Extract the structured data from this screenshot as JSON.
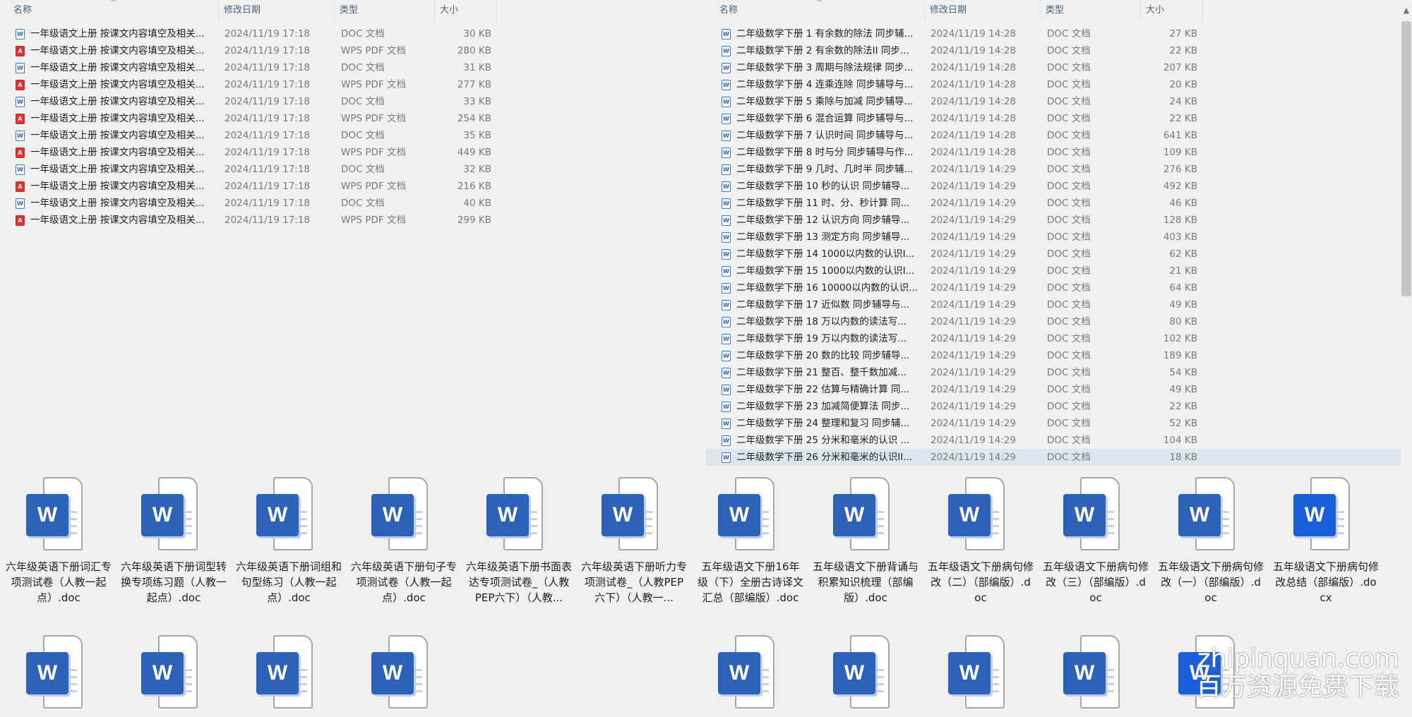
{
  "headers": {
    "name": "名称",
    "date": "修改日期",
    "type": "类型",
    "size": "大小"
  },
  "left_files": [
    {
      "name": "一年级语文上册 按课文内容填空及相关...",
      "date": "2024/11/19 17:18",
      "type": "DOC 文档",
      "size": "30 KB",
      "icon": "word-doc-icon"
    },
    {
      "name": "一年级语文上册 按课文内容填空及相关...",
      "date": "2024/11/19 17:18",
      "type": "WPS PDF 文档",
      "size": "280 KB",
      "icon": "pdf-icon"
    },
    {
      "name": "一年级语文上册 按课文内容填空及相关...",
      "date": "2024/11/19 17:18",
      "type": "DOC 文档",
      "size": "31 KB",
      "icon": "word-doc-icon"
    },
    {
      "name": "一年级语文上册 按课文内容填空及相关...",
      "date": "2024/11/19 17:18",
      "type": "WPS PDF 文档",
      "size": "277 KB",
      "icon": "pdf-icon"
    },
    {
      "name": "一年级语文上册 按课文内容填空及相关...",
      "date": "2024/11/19 17:18",
      "type": "DOC 文档",
      "size": "33 KB",
      "icon": "word-doc-icon"
    },
    {
      "name": "一年级语文上册 按课文内容填空及相关...",
      "date": "2024/11/19 17:18",
      "type": "WPS PDF 文档",
      "size": "254 KB",
      "icon": "pdf-icon"
    },
    {
      "name": "一年级语文上册 按课文内容填空及相关...",
      "date": "2024/11/19 17:18",
      "type": "DOC 文档",
      "size": "35 KB",
      "icon": "word-doc-icon"
    },
    {
      "name": "一年级语文上册 按课文内容填空及相关...",
      "date": "2024/11/19 17:18",
      "type": "WPS PDF 文档",
      "size": "449 KB",
      "icon": "pdf-icon"
    },
    {
      "name": "一年级语文上册 按课文内容填空及相关...",
      "date": "2024/11/19 17:18",
      "type": "DOC 文档",
      "size": "32 KB",
      "icon": "word-doc-icon"
    },
    {
      "name": "一年级语文上册 按课文内容填空及相关...",
      "date": "2024/11/19 17:18",
      "type": "WPS PDF 文档",
      "size": "216 KB",
      "icon": "pdf-icon"
    },
    {
      "name": "一年级语文上册 按课文内容填空及相关...",
      "date": "2024/11/19 17:18",
      "type": "DOC 文档",
      "size": "40 KB",
      "icon": "word-doc-icon"
    },
    {
      "name": "一年级语文上册 按课文内容填空及相关...",
      "date": "2024/11/19 17:18",
      "type": "WPS PDF 文档",
      "size": "299 KB",
      "icon": "pdf-icon"
    }
  ],
  "right_files": [
    {
      "name": "二年级数学下册 1 有余数的除法 同步辅...",
      "date": "2024/11/19 14:28",
      "type": "DOC 文档",
      "size": "27 KB"
    },
    {
      "name": "二年级数学下册 2 有余数的除法II 同步...",
      "date": "2024/11/19 14:28",
      "type": "DOC 文档",
      "size": "22 KB"
    },
    {
      "name": "二年级数学下册 3 周期与除法规律 同步...",
      "date": "2024/11/19 14:28",
      "type": "DOC 文档",
      "size": "207 KB"
    },
    {
      "name": "二年级数学下册 4 连乘连除 同步辅导与...",
      "date": "2024/11/19 14:28",
      "type": "DOC 文档",
      "size": "20 KB"
    },
    {
      "name": "二年级数学下册 5 乘除与加减 同步辅导...",
      "date": "2024/11/19 14:28",
      "type": "DOC 文档",
      "size": "24 KB"
    },
    {
      "name": "二年级数学下册 6 混合运算 同步辅导与...",
      "date": "2024/11/19 14:28",
      "type": "DOC 文档",
      "size": "22 KB"
    },
    {
      "name": "二年级数学下册 7 认识时间 同步辅导与...",
      "date": "2024/11/19 14:28",
      "type": "DOC 文档",
      "size": "641 KB"
    },
    {
      "name": "二年级数学下册 8 时与分 同步辅导与作...",
      "date": "2024/11/19 14:28",
      "type": "DOC 文档",
      "size": "109 KB"
    },
    {
      "name": "二年级数学下册 9 几时、几时半 同步辅...",
      "date": "2024/11/19 14:29",
      "type": "DOC 文档",
      "size": "276 KB"
    },
    {
      "name": "二年级数学下册 10 秒的认识 同步辅导...",
      "date": "2024/11/19 14:29",
      "type": "DOC 文档",
      "size": "492 KB"
    },
    {
      "name": "二年级数学下册 11 时、分、秒计算 同...",
      "date": "2024/11/19 14:29",
      "type": "DOC 文档",
      "size": "46 KB"
    },
    {
      "name": "二年级数学下册 12 认识方向 同步辅导...",
      "date": "2024/11/19 14:29",
      "type": "DOC 文档",
      "size": "128 KB"
    },
    {
      "name": "二年级数学下册 13 测定方向 同步辅导...",
      "date": "2024/11/19 14:29",
      "type": "DOC 文档",
      "size": "403 KB"
    },
    {
      "name": "二年级数学下册 14 1000以内数的认识I...",
      "date": "2024/11/19 14:29",
      "type": "DOC 文档",
      "size": "62 KB"
    },
    {
      "name": "二年级数学下册 15 1000以内数的认识I...",
      "date": "2024/11/19 14:29",
      "type": "DOC 文档",
      "size": "21 KB"
    },
    {
      "name": "二年级数学下册 16 10000以内数的认识...",
      "date": "2024/11/19 14:29",
      "type": "DOC 文档",
      "size": "64 KB"
    },
    {
      "name": "二年级数学下册 17 近似数 同步辅导与...",
      "date": "2024/11/19 14:29",
      "type": "DOC 文档",
      "size": "49 KB"
    },
    {
      "name": "二年级数学下册 18 万以内数的读法写...",
      "date": "2024/11/19 14:29",
      "type": "DOC 文档",
      "size": "80 KB"
    },
    {
      "name": "二年级数学下册 19 万以内数的读法写...",
      "date": "2024/11/19 14:29",
      "type": "DOC 文档",
      "size": "102 KB"
    },
    {
      "name": "二年级数学下册 20 数的比较 同步辅导...",
      "date": "2024/11/19 14:29",
      "type": "DOC 文档",
      "size": "189 KB"
    },
    {
      "name": "二年级数学下册 21 整百、整千数加减...",
      "date": "2024/11/19 14:29",
      "type": "DOC 文档",
      "size": "54 KB"
    },
    {
      "name": "二年级数学下册 22 估算与精确计算 同...",
      "date": "2024/11/19 14:29",
      "type": "DOC 文档",
      "size": "49 KB"
    },
    {
      "name": "二年级数学下册 23 加减简便算法 同步...",
      "date": "2024/11/19 14:29",
      "type": "DOC 文档",
      "size": "22 KB"
    },
    {
      "name": "二年级数学下册 24 整理和复习 同步辅...",
      "date": "2024/11/19 14:29",
      "type": "DOC 文档",
      "size": "52 KB"
    },
    {
      "name": "二年级数学下册 25 分米和毫米的认识 ...",
      "date": "2024/11/19 14:29",
      "type": "DOC 文档",
      "size": "104 KB"
    },
    {
      "name": "二年级数学下册 26 分米和毫米的认识II...",
      "date": "2024/11/19 14:29",
      "type": "DOC 文档",
      "size": "18 KB"
    }
  ],
  "left_tiles": [
    {
      "label": "六年级英语下册词汇专项测试卷（人教一起点）.doc"
    },
    {
      "label": "六年级英语下册词型转换专项练习题（人教一起点）.doc"
    },
    {
      "label": "六年级英语下册词组和句型练习（人教一起点）.doc"
    },
    {
      "label": "六年级英语下册句子专项测试卷（人教一起点）.doc"
    },
    {
      "label": "六年级英语下册书面表达专项测试卷_（人教PEP六下）（人教..."
    },
    {
      "label": "六年级英语下册听力专项测试卷_（人教PEP六下）（人教一..."
    },
    {
      "label": ""
    },
    {
      "label": ""
    },
    {
      "label": ""
    },
    {
      "label": ""
    }
  ],
  "right_tiles": [
    {
      "label": "五年级语文下册16年级（下）全册古诗译文汇总（部编版）.doc",
      "badge": "normal"
    },
    {
      "label": "五年级语文下册背诵与积累知识梳理（部编版）.doc",
      "badge": "normal"
    },
    {
      "label": "五年级语文下册病句修改（二）（部编版）.doc",
      "badge": "normal"
    },
    {
      "label": "五年级语文下册病句修改（三）（部编版）.doc",
      "badge": "normal"
    },
    {
      "label": "五年级语文下册病句修改（一）（部编版）.doc",
      "badge": "normal"
    },
    {
      "label": "五年级语文下册病句修改总结（部编版）.docx",
      "badge": "dark"
    },
    {
      "label": "",
      "badge": "normal"
    },
    {
      "label": "",
      "badge": "normal"
    },
    {
      "label": "",
      "badge": "normal"
    },
    {
      "label": "",
      "badge": "normal"
    },
    {
      "label": "",
      "badge": "dark"
    }
  ],
  "badge_letter": "W",
  "pdf_letter": "A",
  "watermark": {
    "line1": "zhipinquan.com",
    "line2": "百万资源免费下载"
  }
}
